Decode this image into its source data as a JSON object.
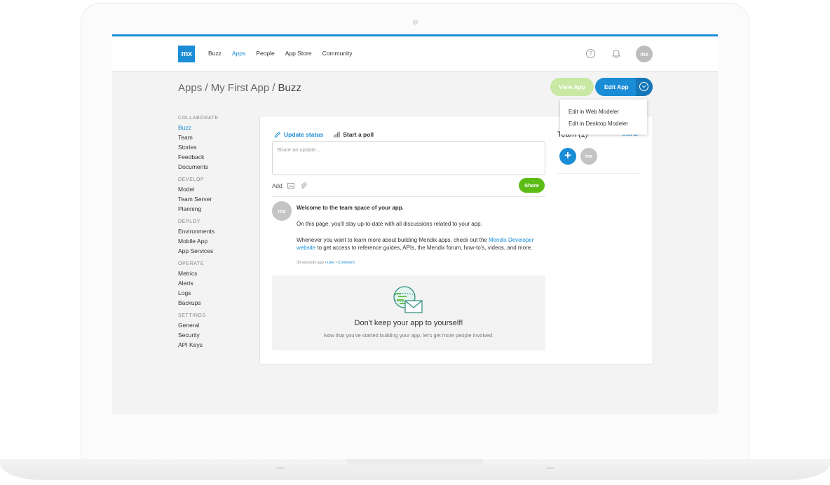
{
  "topnav": {
    "logo": "mx",
    "items": [
      {
        "label": "Buzz",
        "active": false
      },
      {
        "label": "Apps",
        "active": true
      },
      {
        "label": "People",
        "active": false
      },
      {
        "label": "App Store",
        "active": false
      },
      {
        "label": "Community",
        "active": false
      }
    ],
    "help_icon": "?",
    "avatar": "mx"
  },
  "header": {
    "breadcrumb_prefix": "Apps / My First App / ",
    "breadcrumb_current": "Buzz",
    "view_app_label": "View App",
    "edit_app_label": "Edit App"
  },
  "edit_menu": {
    "items": [
      "Edit in Web Modeler",
      "Edit in Desktop Modeler"
    ]
  },
  "sidebar": {
    "sections": [
      {
        "title": "COLLABORATE",
        "items": [
          "Buzz",
          "Team",
          "Stories",
          "Feedback",
          "Documents"
        ]
      },
      {
        "title": "DEVELOP",
        "items": [
          "Model",
          "Team Server",
          "Planning"
        ]
      },
      {
        "title": "DEPLOY",
        "items": [
          "Environments",
          "Mobile App",
          "App Services"
        ]
      },
      {
        "title": "OPERATE",
        "items": [
          "Metrics",
          "Alerts",
          "Logs",
          "Backups"
        ]
      },
      {
        "title": "SETTINGS",
        "items": [
          "General",
          "Security",
          "API Keys"
        ]
      }
    ],
    "active_item": "Buzz"
  },
  "composer": {
    "tab_update": "Update status",
    "tab_poll": "Start a poll",
    "placeholder": "Share an update...",
    "add_label": "Add:",
    "share_label": "Share"
  },
  "post": {
    "avatar": "mx",
    "title": "Welcome to the team space of your app.",
    "paragraph1": "On this page, you'll stay up-to-date with all discussions related to your app.",
    "paragraph2_before": "Whenever you want to learn more about building Mendix apps, check out the ",
    "paragraph2_link": "Mendix Developer website",
    "paragraph2_after": " to get access to reference guides, APIs, the Mendix forum, how-to's, videos, and more.",
    "time": "30 seconds ago",
    "sep1": " • ",
    "like": "Like",
    "sep2": " • ",
    "comment": "Comment"
  },
  "invite": {
    "title": "Don't keep your app to yourself!",
    "subtitle": "Now that you've started building your app, let's get more people involved."
  },
  "team": {
    "title": "Team (1)",
    "show_all": "Show all",
    "add_label": "+",
    "member_avatar": "mx"
  },
  "colors": {
    "accent": "#1a8dd6",
    "share_green": "#5dbb16",
    "view_app_green": "#c8e8a4"
  }
}
